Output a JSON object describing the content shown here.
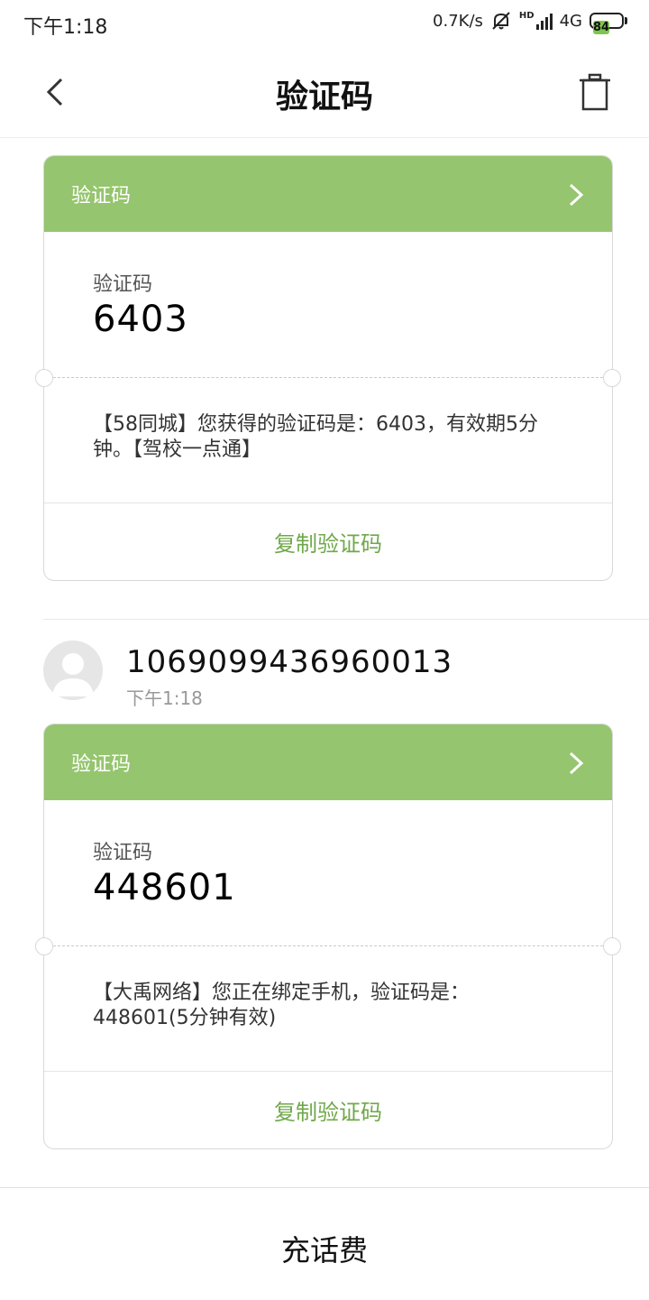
{
  "status_bar": {
    "time": "下午1:18",
    "net_speed": "0.7K/s",
    "network": "4G",
    "hd_label": "HD",
    "battery": "84",
    "icons": [
      "mute-bell-icon",
      "signal-icon",
      "battery-icon"
    ]
  },
  "header": {
    "title": "验证码",
    "back_icon": "back-chevron-icon",
    "delete_icon": "trash-icon"
  },
  "messages": [
    {
      "card_title": "验证码",
      "code_label": "验证码",
      "code": "6403",
      "text": "【58同城】您获得的验证码是：6403，有效期5分钟。【驾校一点通】",
      "copy_label": "复制验证码"
    },
    {
      "sender_number": "106909943696001​3",
      "sender_time": "下午1:18",
      "card_title": "验证码",
      "code_label": "验证码",
      "code": "448601",
      "text": "【大禹网络】您正在绑定手机，验证码是：448601(5分钟有效)",
      "copy_label": "复制验证码"
    }
  ],
  "bottom_bar": {
    "recharge_label": "充话费"
  },
  "colors": {
    "card_header": "#95c56e",
    "copy_text": "#6fa84a"
  }
}
